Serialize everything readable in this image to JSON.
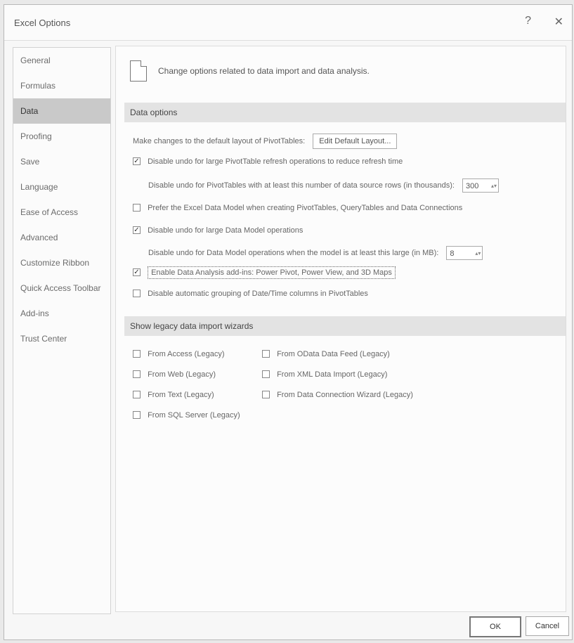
{
  "window": {
    "title": "Excel Options",
    "help_glyph": "?",
    "close_glyph": "✕"
  },
  "sidebar": {
    "items": [
      {
        "label": "General"
      },
      {
        "label": "Formulas"
      },
      {
        "label": "Data"
      },
      {
        "label": "Proofing"
      },
      {
        "label": "Save"
      },
      {
        "label": "Language"
      },
      {
        "label": "Ease of Access"
      },
      {
        "label": "Advanced"
      },
      {
        "label": "Customize Ribbon"
      },
      {
        "label": "Quick Access Toolbar"
      },
      {
        "label": "Add-ins"
      },
      {
        "label": "Trust Center"
      }
    ],
    "active_index": 2
  },
  "main": {
    "header": "Change options related to data import and data analysis.",
    "data_options": {
      "title": "Data options",
      "default_layout_text": "Make changes to the default layout of PivotTables:",
      "edit_layout_button": "Edit Default Layout...",
      "undo_pivot_label": "Disable undo for large PivotTable refresh operations to reduce refresh time",
      "undo_pivot_checked": true,
      "pivot_rows_text": "Disable undo for PivotTables with at least this number of data source rows (in thousands):",
      "pivot_rows_value": "300",
      "prefer_data_model_label": "Prefer the Excel Data Model when creating PivotTables, QueryTables and Data Connections",
      "prefer_data_model_checked": false,
      "undo_data_model_label": "Disable undo for large Data Model operations",
      "undo_data_model_checked": true,
      "data_model_size_text": "Disable undo for Data Model operations when the model is at least this large (in MB):",
      "data_model_size_value": "8",
      "enable_addins_label": "Enable Data Analysis add-ins: Power Pivot, Power View, and 3D Maps",
      "enable_addins_checked": true,
      "disable_grouping_label": "Disable automatic grouping of Date/Time columns in PivotTables",
      "disable_grouping_checked": false
    },
    "legacy": {
      "title": "Show legacy data import wizards",
      "items": [
        {
          "label": "From Access (Legacy)",
          "checked": false
        },
        {
          "label": "From OData Data Feed (Legacy)",
          "checked": false
        },
        {
          "label": "From Web (Legacy)",
          "checked": false
        },
        {
          "label": "From XML Data Import (Legacy)",
          "checked": false
        },
        {
          "label": "From Text (Legacy)",
          "checked": false
        },
        {
          "label": "From Data Connection Wizard (Legacy)",
          "checked": false
        },
        {
          "label": "From SQL Server (Legacy)",
          "checked": false
        }
      ]
    }
  },
  "footer": {
    "ok": "OK",
    "cancel": "Cancel"
  }
}
